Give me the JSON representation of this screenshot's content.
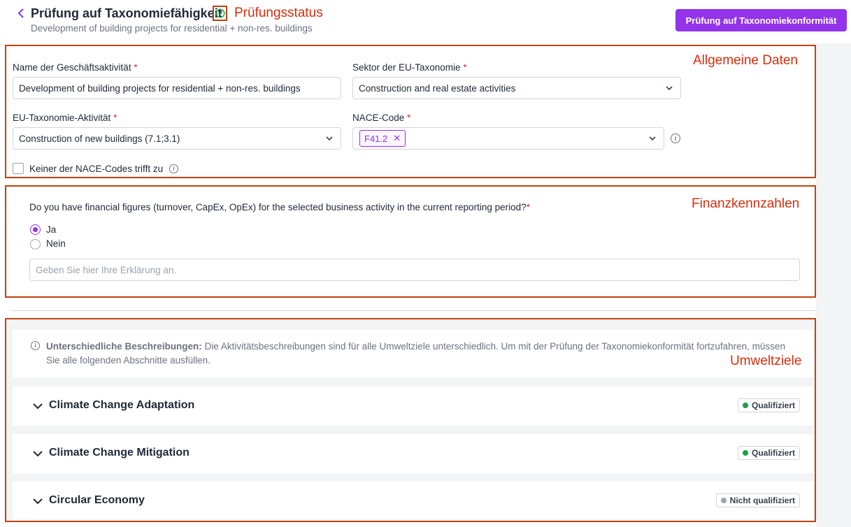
{
  "header": {
    "back_icon": "chevron-left-icon",
    "title": "Prüfung auf Taxonomiefähigkeit",
    "status_icon": "check-circle-icon",
    "status_annotation": "Prüfungsstatus",
    "subtitle": "Development of building projects for residential + non-res. buildings",
    "primary_button": "Prüfung auf Taxonomiekonformität",
    "accent_color": "#9333ea"
  },
  "general": {
    "annotation": "Allgemeine Daten",
    "activity_name_label": "Name der Geschäftsaktivität",
    "activity_name_value": "Development of building projects for residential + non-res. buildings",
    "sector_label": "Sektor der EU-Taxonomie",
    "sector_value": "Construction and real estate activities",
    "eu_activity_label": "EU-Taxonomie-Aktivität",
    "eu_activity_value": "Construction of new buildings (7.1;3.1)",
    "nace_label": "NACE-Code",
    "nace_chips": [
      "F41.2"
    ],
    "no_nace_label": "Keiner der NACE-Codes trifft zu",
    "required_mark": "*"
  },
  "finance": {
    "annotation": "Finanzkennzahlen",
    "question": "Do you have financial figures (turnover, CapEx, OpEx) for the selected business activity in the current reporting period?",
    "options": [
      {
        "label": "Ja",
        "selected": true
      },
      {
        "label": "Nein",
        "selected": false
      }
    ],
    "explanation_placeholder": "Geben Sie hier Ihre Erklärung an."
  },
  "environmental": {
    "annotation": "Umweltziele",
    "notice_title": "Unterschiedliche Beschreibungen:",
    "notice_body": " Die Aktivitätsbeschreibungen sind für alle Umweltziele unterschiedlich. Um mit der Prüfung der Taxonomiekonformität fortzufahren, müssen Sie alle folgenden Abschnitte ausfüllen.",
    "objectives": [
      {
        "title": "Climate Change Adaptation",
        "status": "Qualifiziert",
        "status_color": "#16a34a"
      },
      {
        "title": "Climate Change Mitigation",
        "status": "Qualifiziert",
        "status_color": "#16a34a"
      },
      {
        "title": "Circular Economy",
        "status": "Nicht qualifiziert",
        "status_color": "#9ca3af"
      }
    ]
  }
}
